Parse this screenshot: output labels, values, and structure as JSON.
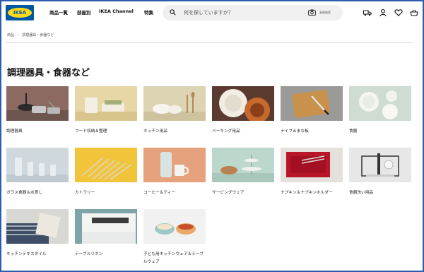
{
  "brand": "IKEA",
  "nav": [
    "商品一覧",
    "部屋別",
    "IKEA Channel",
    "特集"
  ],
  "search": {
    "placeholder": "何を探していますか？",
    "image_search_label": "画像検索"
  },
  "header_icons": [
    "truck-icon",
    "user-icon",
    "heart-icon",
    "basket-icon"
  ],
  "breadcrumb": [
    "商品",
    "調理器具・食器など"
  ],
  "title": "調理器具・食器など",
  "categories": [
    {
      "label": "調理器具"
    },
    {
      "label": "フード収納＆整理"
    },
    {
      "label": "キッチン用品"
    },
    {
      "label": "ベーキング用品"
    },
    {
      "label": "ナイフ＆まな板"
    },
    {
      "label": "食器"
    },
    {
      "label": "ガラス食器＆水差し"
    },
    {
      "label": "カトラリー"
    },
    {
      "label": "コーヒー＆ティー"
    },
    {
      "label": "サービングウェア"
    },
    {
      "label": "ナプキン＆ナプキンホルダー"
    },
    {
      "label": "食器洗い用品"
    },
    {
      "label": "キッチンテキスタイル"
    },
    {
      "label": "テーブルリネン"
    },
    {
      "label": "子ども用キッチンウェア＆テーブルウェア"
    }
  ],
  "colors": {
    "brand_blue": "#0058a3",
    "brand_yellow": "#ffda1a",
    "frame": "#2a5dad"
  }
}
